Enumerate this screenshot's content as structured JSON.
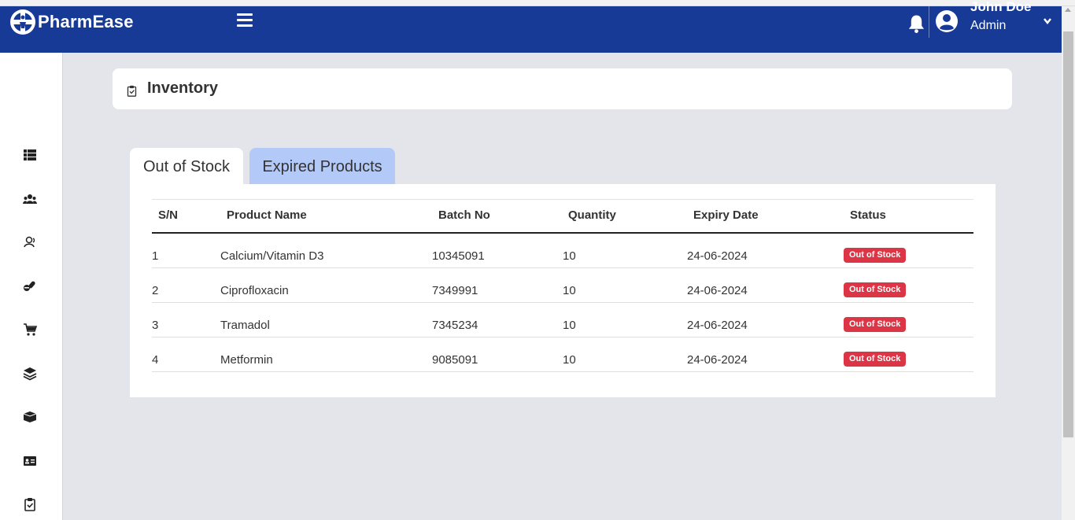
{
  "app": {
    "brand": "PharmEase"
  },
  "user": {
    "name": "John Doe",
    "role": "Admin"
  },
  "page": {
    "title": "Inventory"
  },
  "tabs": [
    {
      "label": "Out of Stock",
      "active": true
    },
    {
      "label": "Expired Products",
      "active": false
    }
  ],
  "table": {
    "headers": [
      "S/N",
      "Product Name",
      "Batch No",
      "Quantity",
      "Expiry Date",
      "Status"
    ],
    "rows": [
      {
        "sn": "1",
        "product": "Calcium/Vitamin D3",
        "batch": "10345091",
        "quantity": "10",
        "expiry": "24-06-2024",
        "status": "Out of Stock"
      },
      {
        "sn": "2",
        "product": "Ciprofloxacin",
        "batch": "7349991",
        "quantity": "10",
        "expiry": "24-06-2024",
        "status": "Out of Stock"
      },
      {
        "sn": "3",
        "product": "Tramadol",
        "batch": "7345234",
        "quantity": "10",
        "expiry": "24-06-2024",
        "status": "Out of Stock"
      },
      {
        "sn": "4",
        "product": "Metformin",
        "batch": "9085091",
        "quantity": "10",
        "expiry": "24-06-2024",
        "status": "Out of Stock"
      }
    ]
  },
  "sidebar": {
    "icons": [
      "dashboard-list-icon",
      "users-group-icon",
      "user-outline-icon",
      "pills-icon",
      "cart-icon",
      "layers-icon",
      "box-icon",
      "id-card-icon",
      "clipboard-check-icon"
    ]
  },
  "colors": {
    "navbar": "#173a96",
    "background": "#e4e5ea",
    "tab_inactive": "#b3c9f8",
    "status_badge": "#dc3545"
  }
}
